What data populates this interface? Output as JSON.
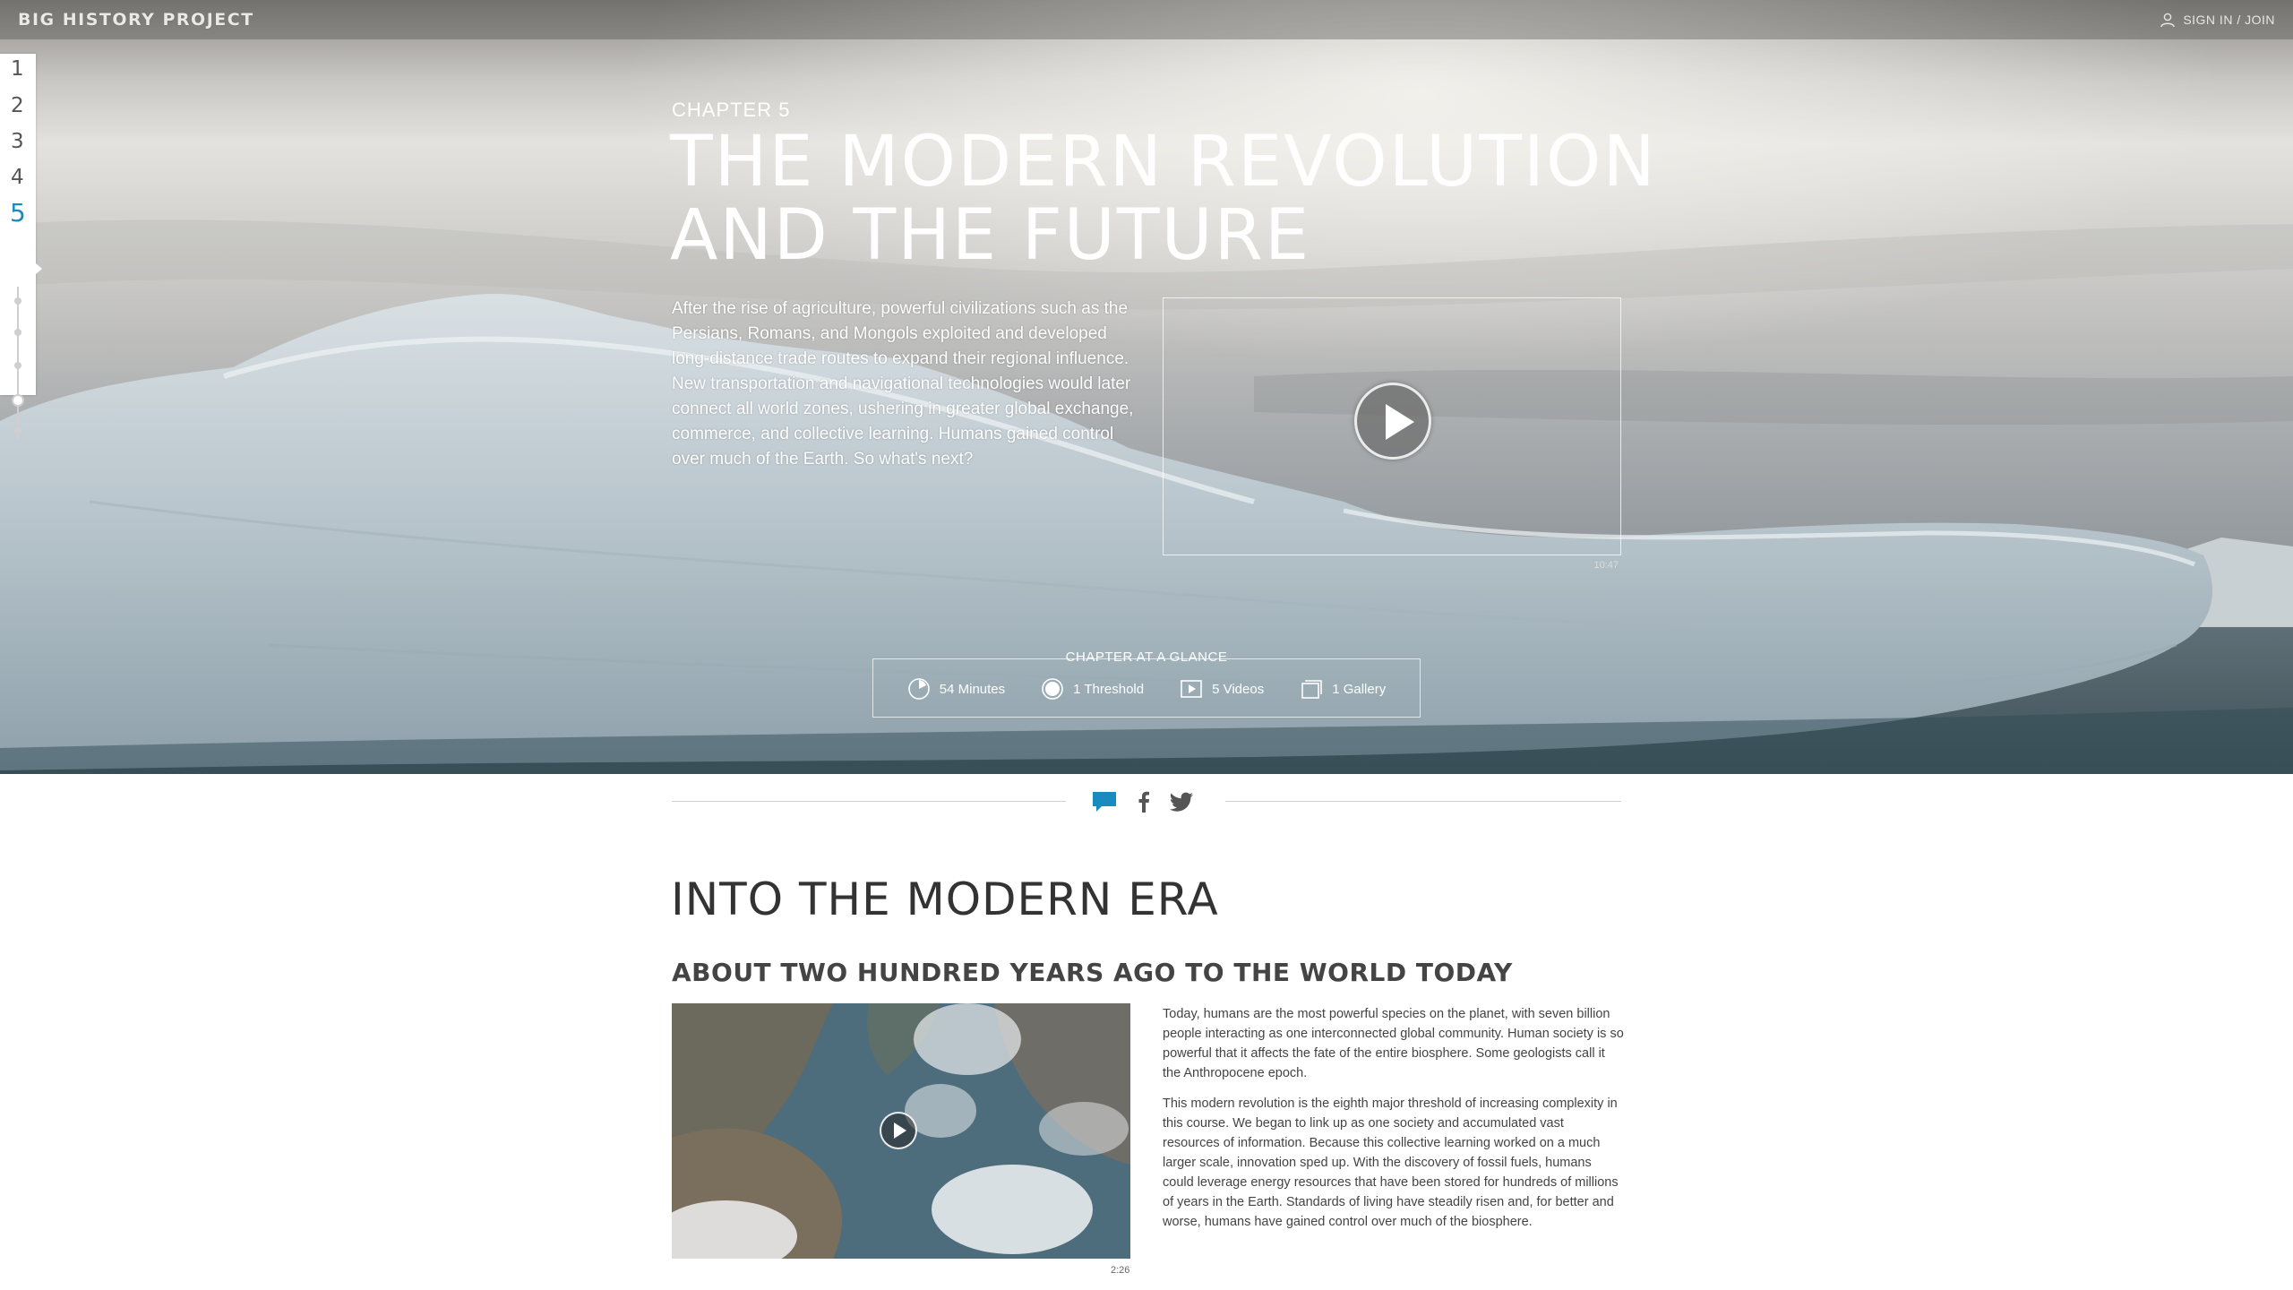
{
  "header": {
    "logo": "BIG HISTORY PROJECT",
    "signin": "SIGN IN / JOIN"
  },
  "rail": {
    "chapters": [
      "1",
      "2",
      "3",
      "4",
      "5"
    ],
    "active": "5"
  },
  "hero": {
    "chapter_label": "CHAPTER 5",
    "title": "THE MODERN REVOLUTION AND THE FUTURE",
    "intro": "After the rise of agriculture, powerful civilizations such as the Persians, Romans, and Mongols exploited and developed long-distance trade routes to expand their regional influence. New transportation and navigational technologies would later connect all world zones, ushering in greater global exchange, commerce, and collective learning. Humans gained control over much of the Earth. So what's next?",
    "video_duration": "10:47"
  },
  "glance": {
    "title": "CHAPTER AT A GLANCE",
    "items": [
      {
        "icon": "clock-icon",
        "label": "54 Minutes"
      },
      {
        "icon": "threshold-icon",
        "label": "1 Threshold"
      },
      {
        "icon": "video-icon",
        "label": "5 Videos"
      },
      {
        "icon": "gallery-icon",
        "label": "1 Gallery"
      }
    ]
  },
  "share": {
    "icons": [
      "comment-icon",
      "facebook-icon",
      "twitter-icon"
    ],
    "accent": "#1a8bbf"
  },
  "section": {
    "title": "INTO THE MODERN ERA",
    "subtitle": "ABOUT TWO HUNDRED YEARS AGO TO THE WORLD TODAY",
    "video_duration": "2:26",
    "paragraphs": [
      "Today, humans are the most powerful species on the planet, with seven billion people interacting as one interconnected global community. Human society is so powerful that it affects the fate of the entire biosphere. Some geologists call it the Anthropocene epoch.",
      "This modern revolution is the eighth major threshold of increasing complexity in this course. We began to link up as one society and accumulated vast resources of information. Because this collective learning worked on a much larger scale, innovation sped up. With the discovery of fossil fuels, humans could leverage energy resources that have been stored for hundreds of millions of years in the Earth. Standards of living have steadily risen and, for better and worse, humans have gained control over much of the biosphere."
    ]
  }
}
